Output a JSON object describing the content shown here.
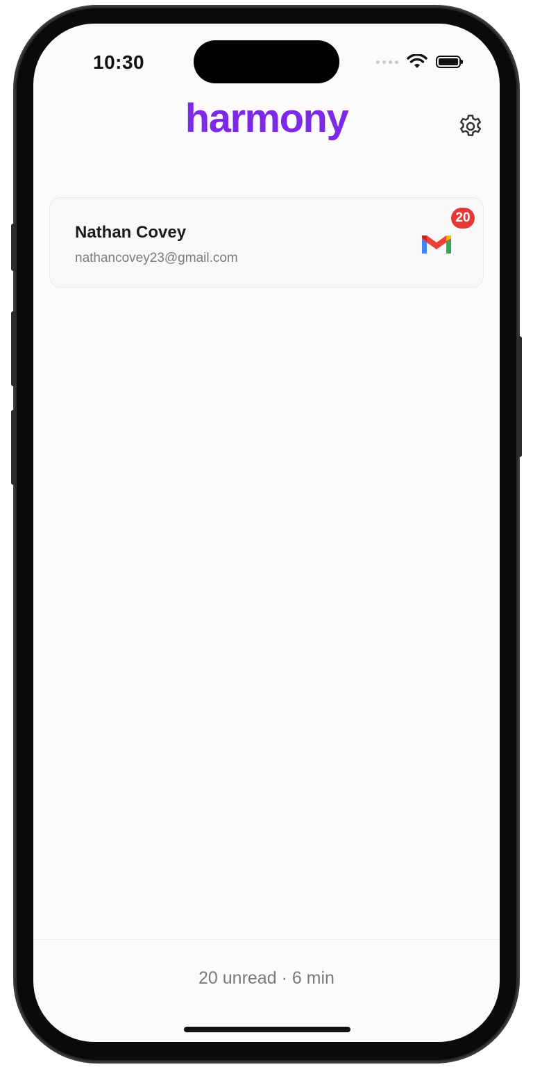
{
  "status_bar": {
    "time": "10:30"
  },
  "header": {
    "logo_text": "harmony",
    "brand_color": "#7c2ae8",
    "settings_icon": "gear-icon"
  },
  "accounts": [
    {
      "name": "Nathan Covey",
      "email": "nathancovey23@gmail.com",
      "provider_icon": "gmail-icon",
      "unread_badge": "20"
    }
  ],
  "footer": {
    "summary": "20 unread · 6 min"
  },
  "colors": {
    "badge": "#e53935",
    "background": "#fbfbfb"
  }
}
